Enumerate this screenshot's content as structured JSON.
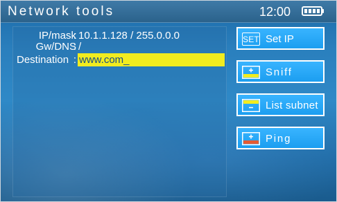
{
  "header": {
    "title": "Network tools",
    "time": "12:00"
  },
  "info": {
    "ip_mask_label": "IP/mask",
    "ip_mask_value": "10.1.1.128 / 255.0.0.0",
    "gw_dns_label": "Gw/DNS",
    "gw_dns_value": "/",
    "destination_label": "Destination",
    "destination_value": "www.com_",
    "separator": ":"
  },
  "buttons": {
    "set_ip": {
      "icon_text": "SET",
      "label": "Set IP"
    },
    "sniff": {
      "label": "Sniff"
    },
    "list_subnet": {
      "label": "List subnet"
    },
    "ping": {
      "label": "Ping"
    }
  },
  "colors": {
    "accent_blue": "#22a6f2",
    "input_yellow": "#f1ec1f",
    "ping_red": "#e45b33"
  },
  "icons": {
    "battery": "battery-icon",
    "set_ip": "set-icon",
    "sniff": "plus-yellow-icon",
    "list_subnet": "minus-yellow-icon",
    "ping": "plus-red-icon"
  }
}
